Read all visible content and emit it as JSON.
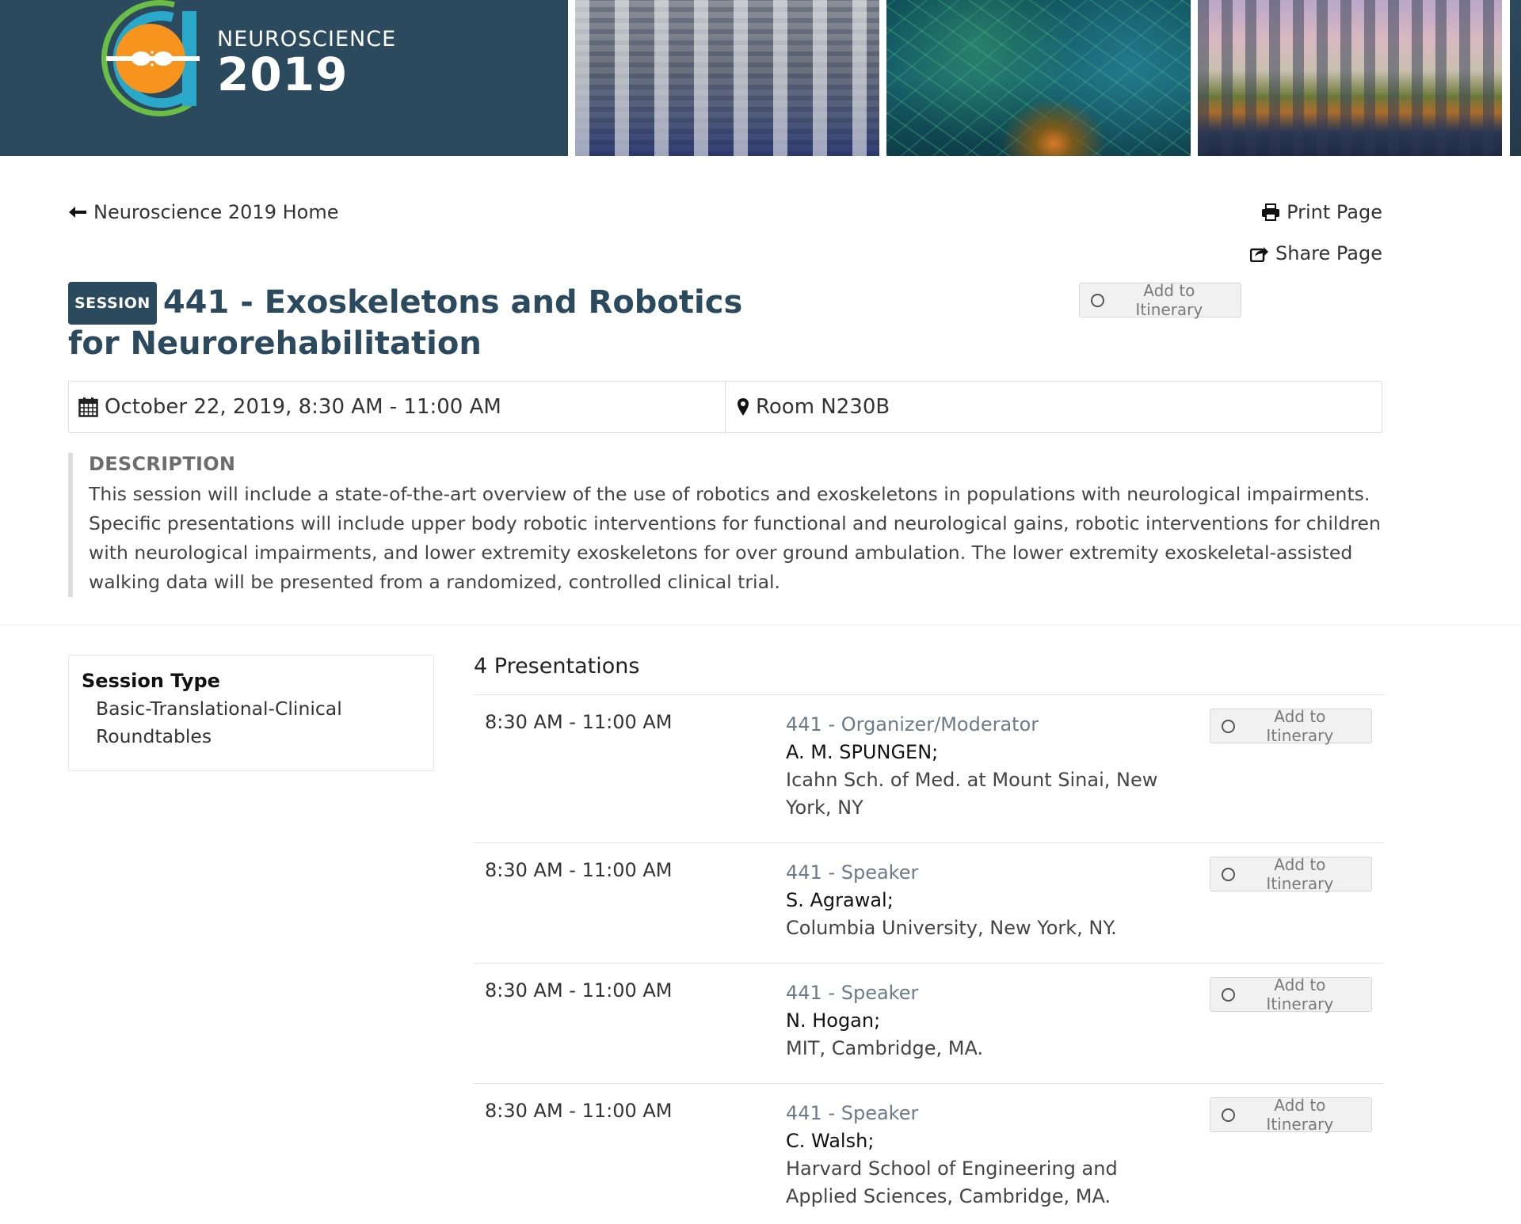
{
  "banner": {
    "logo_line1": "NEUROSCIENCE",
    "logo_year": "2019",
    "brand_color": "#2c4a5e",
    "logo_orange": "#f7941d",
    "logo_teal": "#29a8c9",
    "logo_green": "#6abd45"
  },
  "nav": {
    "home_label": "Neuroscience 2019 Home",
    "print_label": "Print Page",
    "share_label": "Share Page"
  },
  "session": {
    "badge": "SESSION",
    "title": "441 - Exoskeletons and Robotics for Neurorehabilitation",
    "itinerary_label": "Add to Itinerary",
    "datetime": "October 22, 2019, 8:30 AM - 11:00 AM",
    "room": "Room N230B"
  },
  "description": {
    "heading": "DESCRIPTION",
    "text": "This session will include a state-of-the-art overview of the use of robotics and exoskeletons in populations with neurological impairments. Specific presentations will include upper body robotic interventions for functional and neurological gains, robotic interventions for children with neurological impairments, and lower extremity exoskeletons for over ground ambulation. The lower extremity exoskeletal-assisted walking data will be presented from a randomized, controlled clinical trial."
  },
  "session_type": {
    "heading": "Session Type",
    "value": "Basic-Translational-Clinical Roundtables"
  },
  "presentations": {
    "count_label": "4 Presentations",
    "items": [
      {
        "time": "8:30 AM - 11:00 AM",
        "role": "441 - Organizer/Moderator",
        "author": "A. M. SPUNGEN",
        "affiliation": "Icahn Sch. of Med. at Mount Sinai, New York, NY",
        "itinerary_label": "Add to Itinerary"
      },
      {
        "time": "8:30 AM - 11:00 AM",
        "role": "441 - Speaker",
        "author": "S. Agrawal",
        "affiliation": "Columbia University, New York, NY.",
        "itinerary_label": "Add to Itinerary"
      },
      {
        "time": "8:30 AM - 11:00 AM",
        "role": "441 - Speaker",
        "author": "N. Hogan",
        "affiliation": "MIT, Cambridge, MA.",
        "itinerary_label": "Add to Itinerary"
      },
      {
        "time": "8:30 AM - 11:00 AM",
        "role": "441 - Speaker",
        "author": "C. Walsh",
        "affiliation": "Harvard School of Engineering and Applied Sciences, Cambridge, MA.",
        "itinerary_label": "Add to Itinerary"
      }
    ]
  }
}
